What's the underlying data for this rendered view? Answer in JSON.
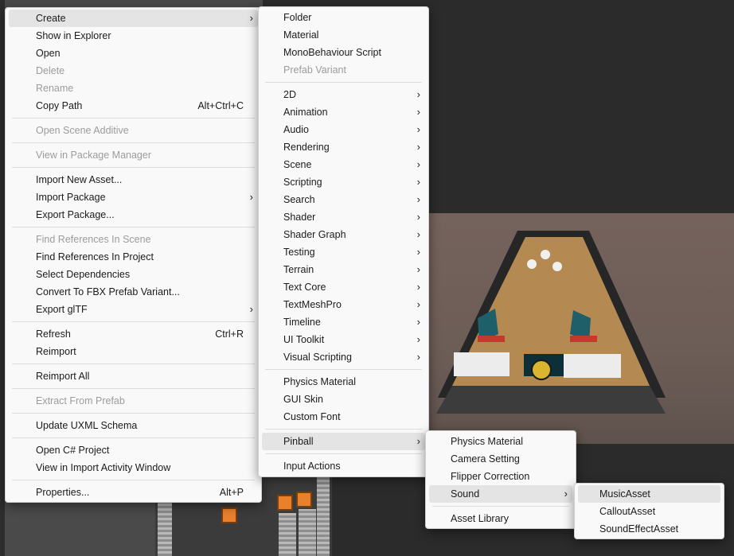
{
  "main_menu": {
    "groups": [
      [
        {
          "label": "Create",
          "arrow": true,
          "highlight": true
        },
        {
          "label": "Show in Explorer"
        },
        {
          "label": "Open"
        },
        {
          "label": "Delete",
          "disabled": true
        },
        {
          "label": "Rename",
          "disabled": true
        },
        {
          "label": "Copy Path",
          "shortcut": "Alt+Ctrl+C"
        }
      ],
      [
        {
          "label": "Open Scene Additive",
          "disabled": true
        }
      ],
      [
        {
          "label": "View in Package Manager",
          "disabled": true
        }
      ],
      [
        {
          "label": "Import New Asset..."
        },
        {
          "label": "Import Package",
          "arrow": true
        },
        {
          "label": "Export Package..."
        }
      ],
      [
        {
          "label": "Find References In Scene",
          "disabled": true
        },
        {
          "label": "Find References In Project"
        },
        {
          "label": "Select Dependencies"
        },
        {
          "label": "Convert To FBX Prefab Variant..."
        },
        {
          "label": "Export glTF",
          "arrow": true
        }
      ],
      [
        {
          "label": "Refresh",
          "shortcut": "Ctrl+R"
        },
        {
          "label": "Reimport"
        }
      ],
      [
        {
          "label": "Reimport All"
        }
      ],
      [
        {
          "label": "Extract From Prefab",
          "disabled": true
        }
      ],
      [
        {
          "label": "Update UXML Schema"
        }
      ],
      [
        {
          "label": "Open C# Project"
        },
        {
          "label": "View in Import Activity Window"
        }
      ],
      [
        {
          "label": "Properties...",
          "shortcut": "Alt+P"
        }
      ]
    ]
  },
  "create_menu": {
    "groups": [
      [
        {
          "label": "Folder"
        },
        {
          "label": "Material"
        },
        {
          "label": "MonoBehaviour Script"
        },
        {
          "label": "Prefab Variant",
          "disabled": true
        }
      ],
      [
        {
          "label": "2D",
          "arrow": true
        },
        {
          "label": "Animation",
          "arrow": true
        },
        {
          "label": "Audio",
          "arrow": true
        },
        {
          "label": "Rendering",
          "arrow": true
        },
        {
          "label": "Scene",
          "arrow": true
        },
        {
          "label": "Scripting",
          "arrow": true
        },
        {
          "label": "Search",
          "arrow": true
        },
        {
          "label": "Shader",
          "arrow": true
        },
        {
          "label": "Shader Graph",
          "arrow": true
        },
        {
          "label": "Testing",
          "arrow": true
        },
        {
          "label": "Terrain",
          "arrow": true
        },
        {
          "label": "Text Core",
          "arrow": true
        },
        {
          "label": "TextMeshPro",
          "arrow": true
        },
        {
          "label": "Timeline",
          "arrow": true
        },
        {
          "label": "UI Toolkit",
          "arrow": true
        },
        {
          "label": "Visual Scripting",
          "arrow": true
        }
      ],
      [
        {
          "label": "Physics Material"
        },
        {
          "label": "GUI Skin"
        },
        {
          "label": "Custom Font"
        }
      ],
      [
        {
          "label": "Pinball",
          "arrow": true,
          "highlight": true
        }
      ],
      [
        {
          "label": "Input Actions"
        }
      ]
    ]
  },
  "pinball_menu": {
    "groups": [
      [
        {
          "label": "Physics Material"
        },
        {
          "label": "Camera Setting"
        },
        {
          "label": "Flipper Correction"
        },
        {
          "label": "Sound",
          "arrow": true,
          "highlight": true
        }
      ],
      [
        {
          "label": "Asset Library"
        }
      ]
    ]
  },
  "sound_menu": {
    "groups": [
      [
        {
          "label": "MusicAsset",
          "highlight": true
        },
        {
          "label": "CalloutAsset"
        },
        {
          "label": "SoundEffectAsset"
        }
      ]
    ]
  },
  "icons": {
    "submenu_arrow": "›"
  },
  "colors": {
    "menu_bg": "#f9f9f9",
    "highlight": "#e4e4e4",
    "disabled_text": "#9c9c9c",
    "separator": "#dcdcdc",
    "cube_orange": "#e9812c"
  }
}
